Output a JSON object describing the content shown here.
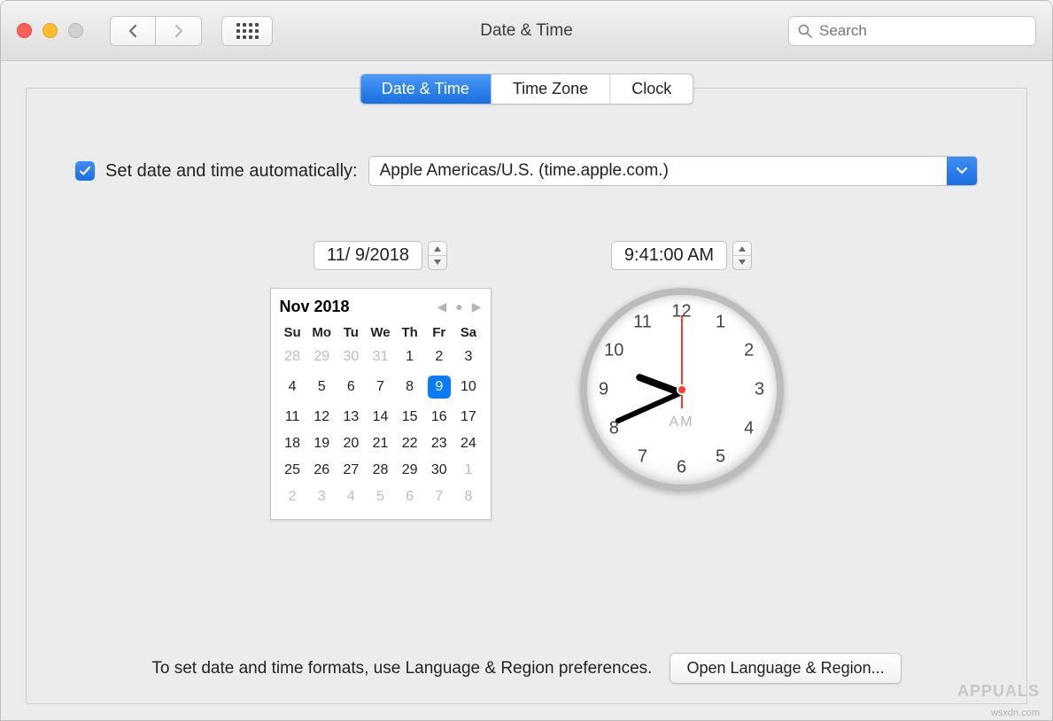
{
  "window": {
    "title": "Date & Time"
  },
  "toolbar": {
    "search_placeholder": "Search"
  },
  "tabs": {
    "date_time": "Date & Time",
    "time_zone": "Time Zone",
    "clock": "Clock",
    "active": "date_time"
  },
  "auto": {
    "checked": true,
    "label": "Set date and time automatically:",
    "server": "Apple Americas/U.S. (time.apple.com.)"
  },
  "date_field": "11/ 9/2018",
  "time_field": "9:41:00 AM",
  "calendar": {
    "month_label": "Nov 2018",
    "weekdays": [
      "Su",
      "Mo",
      "Tu",
      "We",
      "Th",
      "Fr",
      "Sa"
    ],
    "rows": [
      [
        {
          "d": "28",
          "m": true
        },
        {
          "d": "29",
          "m": true
        },
        {
          "d": "30",
          "m": true
        },
        {
          "d": "31",
          "m": true
        },
        {
          "d": "1"
        },
        {
          "d": "2"
        },
        {
          "d": "3"
        }
      ],
      [
        {
          "d": "4"
        },
        {
          "d": "5"
        },
        {
          "d": "6"
        },
        {
          "d": "7"
        },
        {
          "d": "8"
        },
        {
          "d": "9",
          "sel": true
        },
        {
          "d": "10"
        }
      ],
      [
        {
          "d": "11"
        },
        {
          "d": "12"
        },
        {
          "d": "13"
        },
        {
          "d": "14"
        },
        {
          "d": "15"
        },
        {
          "d": "16"
        },
        {
          "d": "17"
        }
      ],
      [
        {
          "d": "18"
        },
        {
          "d": "19"
        },
        {
          "d": "20"
        },
        {
          "d": "21"
        },
        {
          "d": "22"
        },
        {
          "d": "23"
        },
        {
          "d": "24"
        }
      ],
      [
        {
          "d": "25"
        },
        {
          "d": "26"
        },
        {
          "d": "27"
        },
        {
          "d": "28"
        },
        {
          "d": "29"
        },
        {
          "d": "30"
        },
        {
          "d": "1",
          "m": true
        }
      ],
      [
        {
          "d": "2",
          "m": true
        },
        {
          "d": "3",
          "m": true
        },
        {
          "d": "4",
          "m": true
        },
        {
          "d": "5",
          "m": true
        },
        {
          "d": "6",
          "m": true
        },
        {
          "d": "7",
          "m": true
        },
        {
          "d": "8",
          "m": true
        }
      ]
    ]
  },
  "clock": {
    "hour": 9,
    "minute": 41,
    "second": 0,
    "ampm": "AM"
  },
  "footer": {
    "hint": "To set date and time formats, use Language & Region preferences.",
    "button": "Open Language & Region..."
  },
  "watermarks": {
    "site": "wsxdn.com",
    "brand": "APPUALS"
  }
}
